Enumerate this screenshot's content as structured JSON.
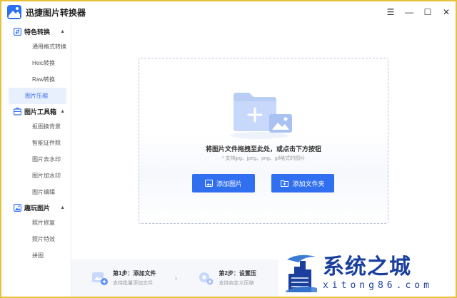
{
  "app": {
    "title": "迅捷图片转换器"
  },
  "window_controls": {
    "menu": "☰",
    "minimize": "—",
    "maximize": "☐",
    "close": "✕"
  },
  "sidebar": {
    "groups": [
      {
        "label": "特色转换",
        "items": [
          "通用格式转换",
          "Heic转换",
          "Raw转换",
          "图片压缩"
        ]
      },
      {
        "label": "图片工具箱",
        "items": [
          "抠图换背景",
          "智能证件照",
          "图片去水印",
          "图片加水印",
          "图片编辑"
        ]
      },
      {
        "label": "趣玩图片",
        "items": [
          "照片修复",
          "照片特效",
          "拼图"
        ]
      }
    ],
    "active_item": "图片压缩"
  },
  "dropzone": {
    "title": "将图片文件拖拽至此处，或点击下方按钮",
    "hint": "* 支持jpg、jpeg、png、gif格式的图片",
    "add_image_label": "添加图片",
    "add_folder_label": "添加文件夹"
  },
  "steps": [
    {
      "title": "第1步：添加文件",
      "desc": "支持批量添加文件"
    },
    {
      "title": "第2步：设置压",
      "desc": "支持自定义压缩"
    }
  ],
  "watermark": {
    "title": "系统之城",
    "url": "xitong86.com"
  },
  "colors": {
    "accent": "#2f6ff0",
    "border": "#e8c23a",
    "watermark": "#1a3f9c"
  }
}
